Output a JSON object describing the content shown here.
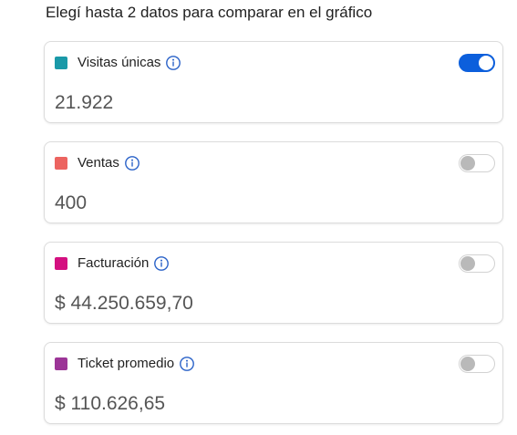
{
  "heading": "Elegí hasta 2 datos para comparar en el gráfico",
  "metrics": [
    {
      "label": "Visitas únicas",
      "value": "21.922",
      "color": "#1a99a8",
      "enabled": true,
      "info_icon": "info-circle-icon"
    },
    {
      "label": "Ventas",
      "value": "400",
      "color": "#ec6460",
      "enabled": false,
      "info_icon": "info-circle-icon"
    },
    {
      "label": "Facturación",
      "value": "$ 44.250.659,70",
      "color": "#d41080",
      "enabled": false,
      "info_icon": "info-circle-icon"
    },
    {
      "label": "Ticket promedio",
      "value": "$ 110.626,65",
      "color": "#9c3597",
      "enabled": false,
      "info_icon": "info-circle-icon"
    }
  ],
  "colors": {
    "toggle_on": "#0c5fdc",
    "toggle_off_knob": "#b9b9b9",
    "info_icon": "#2a62c8"
  }
}
